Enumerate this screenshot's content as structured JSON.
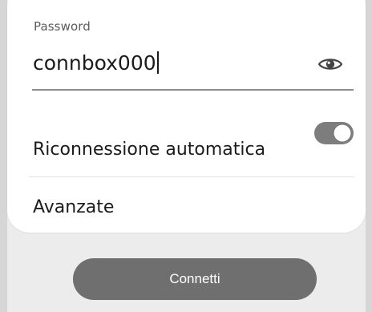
{
  "password": {
    "label": "Password",
    "value": "connbox000"
  },
  "settings": {
    "auto_reconnect_label": "Riconnessione automatica",
    "auto_reconnect_on": true,
    "advanced_label": "Avanzate"
  },
  "actions": {
    "connect_label": "Connetti"
  },
  "icons": {
    "password_visibility": "eye-icon"
  },
  "colors": {
    "toggle_track": "#7d7d7d",
    "connect_button": "#6f6f6f"
  }
}
